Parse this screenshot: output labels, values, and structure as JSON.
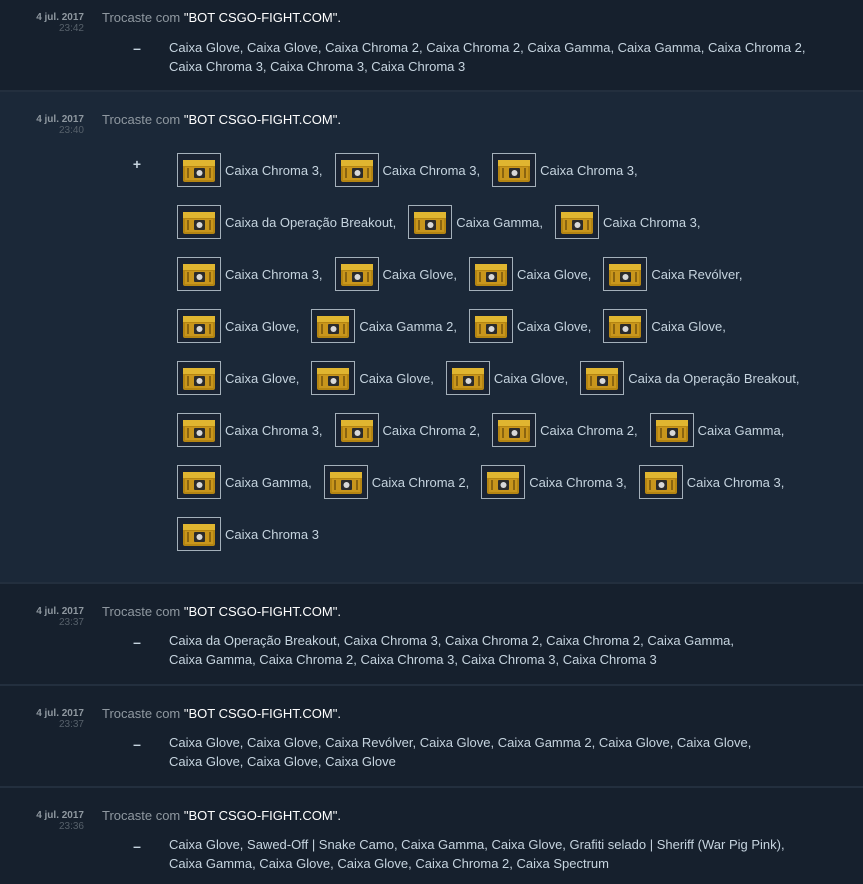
{
  "verb": "Trocaste com",
  "partner": "\"BOT CSGO-FIGHT.COM\".",
  "entries": [
    {
      "date": "4 jul. 2017",
      "time": "23:42",
      "sign": "–",
      "items_line1": "Caixa Glove, Caixa Glove, Caixa Chroma 2, Caixa Chroma 2, Caixa Gamma, Caixa Gamma, Caixa Chroma 2,",
      "items_line2": "Caixa Chroma 3, Caixa Chroma 3, Caixa Chroma 3"
    },
    {
      "date": "4 jul. 2017",
      "time": "23:40",
      "sign": "+",
      "rows": [
        [
          "Caixa Chroma 3,",
          "Caixa Chroma 3,",
          "Caixa Chroma 3,"
        ],
        [
          "Caixa da Operação Breakout,",
          "Caixa Gamma,",
          "Caixa Chroma 3,"
        ],
        [
          "Caixa Chroma 3,",
          "Caixa Glove,",
          "Caixa Glove,",
          "Caixa Revólver,"
        ],
        [
          "Caixa Glove,",
          "Caixa Gamma 2,",
          "Caixa Glove,",
          "Caixa Glove,"
        ],
        [
          "Caixa Glove,",
          "Caixa Glove,",
          "Caixa Glove,",
          "Caixa da Operação Breakout,"
        ],
        [
          "Caixa Chroma 3,",
          "Caixa Chroma 2,",
          "Caixa Chroma 2,",
          "Caixa Gamma,"
        ],
        [
          "Caixa Gamma,",
          "Caixa Chroma 2,",
          "Caixa Chroma 3,",
          "Caixa Chroma 3,"
        ],
        [
          "Caixa Chroma 3"
        ]
      ]
    },
    {
      "date": "4 jul. 2017",
      "time": "23:37",
      "sign": "–",
      "items_line1": "Caixa da Operação Breakout, Caixa Chroma 3, Caixa Chroma 2, Caixa Chroma 2, Caixa Gamma,",
      "items_line2": "Caixa Gamma, Caixa Chroma 2, Caixa Chroma 3, Caixa Chroma 3, Caixa Chroma 3"
    },
    {
      "date": "4 jul. 2017",
      "time": "23:37",
      "sign": "–",
      "items_line1": "Caixa Glove, Caixa Glove, Caixa Revólver, Caixa Glove, Caixa Gamma 2, Caixa Glove, Caixa Glove,",
      "items_line2": "Caixa Glove, Caixa Glove, Caixa Glove"
    },
    {
      "date": "4 jul. 2017",
      "time": "23:36",
      "sign": "–",
      "items_line1": "Caixa Glove, Sawed-Off | Snake Camo, Caixa Gamma, Caixa Glove, Grafiti selado | Sheriff (War Pig Pink),",
      "items_line2": "Caixa Gamma, Caixa Glove, Caixa Glove, Caixa Chroma 2, Caixa Spectrum"
    }
  ]
}
